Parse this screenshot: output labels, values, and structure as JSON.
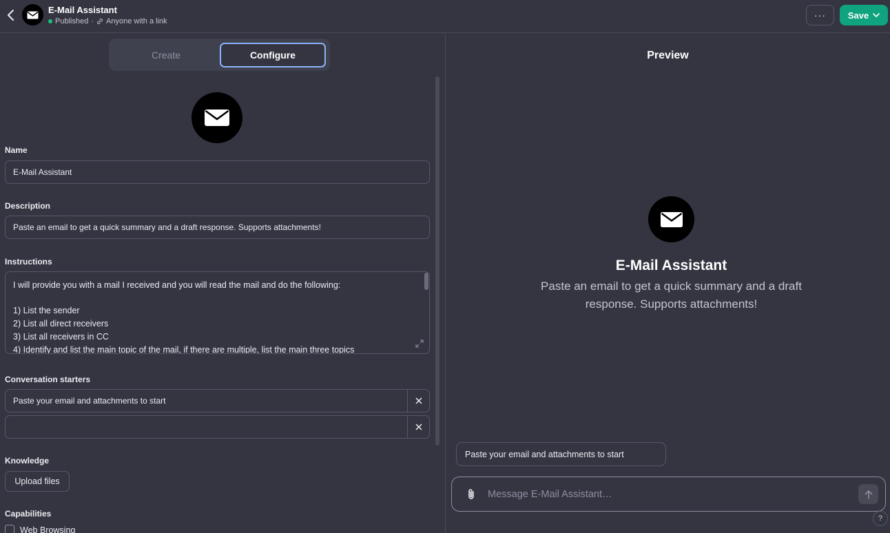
{
  "header": {
    "title": "E-Mail Assistant",
    "status": "Published",
    "separator": "·",
    "visibility": "Anyone with a link",
    "more_label": "···",
    "save_label": "Save"
  },
  "tabs": [
    {
      "label": "Create",
      "active": false
    },
    {
      "label": "Configure",
      "active": true
    }
  ],
  "form": {
    "name_label": "Name",
    "name_value": "E-Mail Assistant",
    "description_label": "Description",
    "description_value": "Paste an email to get a quick summary and a draft response. Supports attachments!",
    "instructions_label": "Instructions",
    "instructions_value": "I will provide you with a mail I received and you will read the mail and do the following:\n\n1) List the sender\n2) List all direct receivers\n3) List all receivers in CC\n4) Identify and list the main topic of the mail, if there are multiple, list the main three topics",
    "starters_label": "Conversation starters",
    "starters": [
      "Paste your email and attachments to start",
      ""
    ],
    "knowledge_label": "Knowledge",
    "upload_label": "Upload files",
    "capabilities_label": "Capabilities",
    "capability_web": "Web Browsing"
  },
  "preview": {
    "title": "Preview",
    "name": "E-Mail Assistant",
    "description": "Paste an email to get a quick summary and a draft response. Supports attachments!",
    "suggestion": "Paste your email and attachments to start",
    "message_placeholder": "Message E-Mail Assistant…",
    "help_label": "?"
  },
  "colors": {
    "background": "#343541",
    "accent_green": "#10a37f",
    "status_green": "#19c37d",
    "active_tab_border": "#8ab4f8"
  },
  "icons": [
    "chevron-left-icon",
    "envelope-icon",
    "link-icon",
    "chevron-down-icon",
    "close-icon",
    "expand-icon",
    "paperclip-icon",
    "arrow-up-icon"
  ]
}
